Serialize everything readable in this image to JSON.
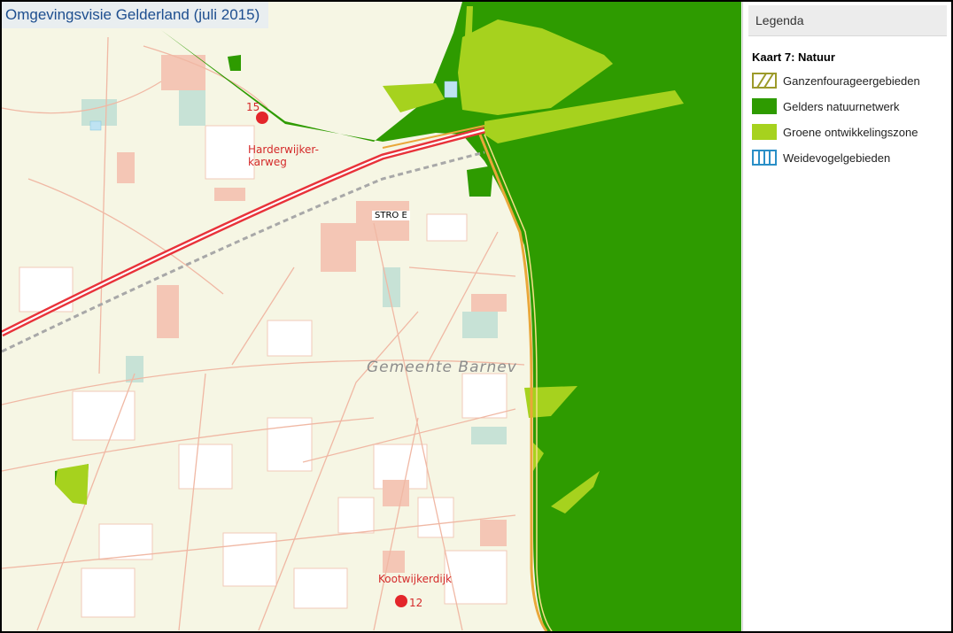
{
  "map": {
    "title": "Omgevingsvisie Gelderland (juli 2015)",
    "municipality_label": "Gemeente  Barnev",
    "place_label": "STRO E",
    "markers": [
      {
        "number": "15",
        "name": "Harderwijker-\nkarweg",
        "color": "#e3262b"
      },
      {
        "number": "12",
        "name": "Kootwijkerdijk",
        "color": "#e3262b"
      }
    ],
    "colors": {
      "natuurnetwerk": "#2e9b00",
      "ontwikkelingszone": "#a6d21e",
      "background": "#f6f6e4",
      "motorway": "#e8323a",
      "marker_label": "#d42a2a"
    }
  },
  "legend": {
    "header": "Legenda",
    "title": "Kaart 7: Natuur",
    "items": [
      {
        "label": "Ganzenfourageergebieden",
        "icon": "hatched-olive-swatch"
      },
      {
        "label": "Gelders natuurnetwerk",
        "icon": "dark-green-swatch",
        "color": "#2e9b00"
      },
      {
        "label": "Groene ontwikkelingszone",
        "icon": "light-green-swatch",
        "color": "#a6d21e"
      },
      {
        "label": "Weidevogelgebieden",
        "icon": "blue-vertical-stripes-swatch"
      }
    ]
  }
}
